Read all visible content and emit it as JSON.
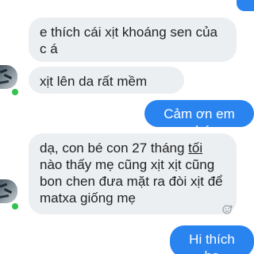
{
  "messages": [
    {
      "direction": "incoming",
      "text": "e thích cái xịt khoáng sen của c á"
    },
    {
      "direction": "incoming",
      "text": "xịt lên da rất mềm"
    },
    {
      "direction": "outgoing",
      "text": "Cảm ơn em nhé"
    },
    {
      "direction": "incoming",
      "text_before": "dạ, con bé con 27 tháng ",
      "text_underlined": "tối",
      "text_after": " nào thấy mẹ cũng xịt xịt cũng bon chen đưa mặt ra đòi xịt để matxa giống mẹ"
    },
    {
      "direction": "outgoing",
      "text": "Hi thích ha"
    }
  ],
  "colors": {
    "outgoing_bubble": "#2a84f0",
    "incoming_bubble": "#eceff2",
    "online_indicator": "#31c24f"
  },
  "icons": {
    "reaction": "smiley-plus-icon",
    "avatar": "contact-avatar"
  }
}
